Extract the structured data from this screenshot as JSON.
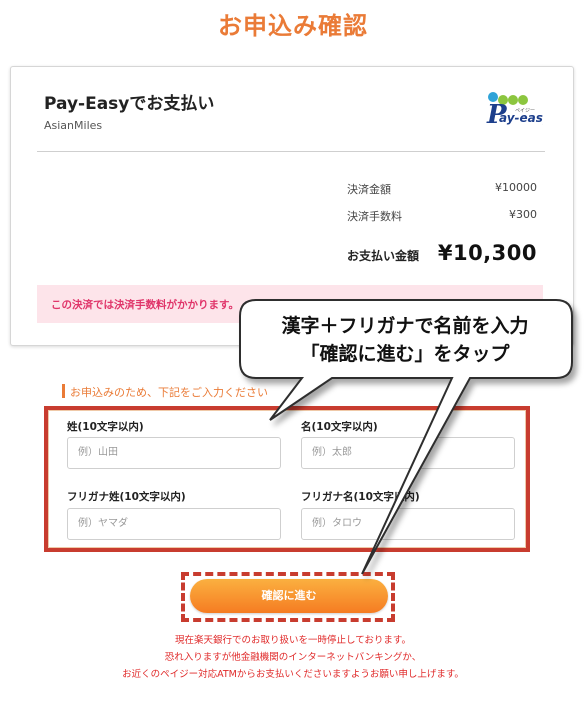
{
  "page": {
    "title": "お申込み確認"
  },
  "payment": {
    "method_title": "Pay-Easyでお支払い",
    "merchant": "AsianMiles",
    "logo_text": "ay-easy",
    "logo_small": "ペイジー",
    "settlement_label": "決済金額",
    "settlement_value": "¥10000",
    "fee_label": "決済手数料",
    "fee_value": "¥300",
    "total_label": "お支払い金額",
    "total_value": "¥10,300",
    "notice": "この決済では決済手数料がかかります。"
  },
  "form": {
    "instruction": "お申込みのため、下記をご入力ください",
    "last_name_label": "姓(10文字以内)",
    "last_name_placeholder": "例）山田",
    "first_name_label": "名(10文字以内)",
    "first_name_placeholder": "例）太郎",
    "last_kana_label": "フリガナ姓(10文字以内)",
    "last_kana_placeholder": "例）ヤマダ",
    "first_kana_label": "フリガナ名(10文字以内)",
    "first_kana_placeholder": "例）タロウ",
    "confirm_button": "確認に進む"
  },
  "footer": {
    "line1": "現在楽天銀行でのお取り扱いを一時停止しております。",
    "line2": "恐れ入りますが他金融機関のインターネットバンキングか、",
    "line3": "お近くのペイジー対応ATMからお支払いくださいますようお願い申し上げます。"
  },
  "callout": {
    "line1": "漢字＋フリガナで名前を入力",
    "line2": "「確認に進む」をタップ"
  },
  "colors": {
    "accent_orange": "#ea7b37",
    "highlight_red": "#c83c2f",
    "notice_pink": "#fde4ea",
    "notice_text": "#e0356a",
    "footer_red": "#e02a2a"
  }
}
